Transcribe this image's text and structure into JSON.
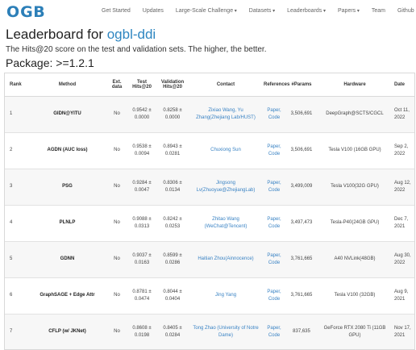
{
  "logo": {
    "text": "GB"
  },
  "nav": [
    {
      "label": "Get Started",
      "dropdown": false
    },
    {
      "label": "Updates",
      "dropdown": false
    },
    {
      "label": "Large-Scale Challenge",
      "dropdown": true
    },
    {
      "label": "Datasets",
      "dropdown": true
    },
    {
      "label": "Leaderboards",
      "dropdown": true
    },
    {
      "label": "Papers",
      "dropdown": true
    },
    {
      "label": "Team",
      "dropdown": false
    },
    {
      "label": "Github",
      "dropdown": false
    }
  ],
  "page": {
    "title_prefix": "Leaderboard for ",
    "title_dataset": "ogbl-ddi",
    "description": "The Hits@20 score on the test and validation sets. The higher, the better.",
    "package": "Package: >=1.2.1"
  },
  "table": {
    "headers": {
      "rank": "Rank",
      "method": "Method",
      "ext": "Ext. data",
      "test": "Test Hits@20",
      "val": "Validation Hits@20",
      "contact": "Contact",
      "refs": "References",
      "params": "#Params",
      "hardware": "Hardware",
      "date": "Date"
    },
    "rows": [
      {
        "rank": "1",
        "method": "GIDN@YITU",
        "ext": "No",
        "test": "0.9542 ± 0.0000",
        "val": "0.8258 ± 0.0000",
        "contact": "Zixiao Wang, Yu Zhang(Zhejiang Lab/HUST)",
        "refs": "Paper, Code",
        "params": "3,506,691",
        "hardware": "DeepGraph@SCTS/CGCL",
        "date": "Oct 11, 2022"
      },
      {
        "rank": "2",
        "method": "AGDN (AUC loss)",
        "ext": "No",
        "test": "0.9538 ± 0.0094",
        "val": "0.8943 ± 0.0281",
        "contact": "Chuxiong Sun",
        "refs": "Paper, Code",
        "params": "3,506,691",
        "hardware": "Tesla V100 (16GB GPU)",
        "date": "Sep 2, 2022"
      },
      {
        "rank": "3",
        "method": "PSG",
        "ext": "No",
        "test": "0.9284 ± 0.0047",
        "val": "0.8306 ± 0.0134",
        "contact": "Jingsong Lv(Zhuoyue@ZhejiangLab)",
        "refs": "Paper, Code",
        "params": "3,499,009",
        "hardware": "Tesla V100(32G GPU)",
        "date": "Aug 12, 2022"
      },
      {
        "rank": "4",
        "method": "PLNLP",
        "ext": "No",
        "test": "0.9088 ± 0.0313",
        "val": "0.8242 ± 0.0253",
        "contact": "Zhitao Wang (WeChat@Tencent)",
        "refs": "Paper, Code",
        "params": "3,497,473",
        "hardware": "Tesla-P40(24GB GPU)",
        "date": "Dec 7, 2021"
      },
      {
        "rank": "5",
        "method": "GDNN",
        "ext": "No",
        "test": "0.9037 ± 0.0163",
        "val": "0.8599 ± 0.0286",
        "contact": "Haitian Zhou(Ainnocence)",
        "refs": "Paper, Code",
        "params": "3,761,665",
        "hardware": "A40 NVLink(48GB)",
        "date": "Aug 30, 2022"
      },
      {
        "rank": "6",
        "method": "GraphSAGE + Edge Attr",
        "ext": "No",
        "test": "0.8781 ± 0.0474",
        "val": "0.8044 ± 0.0404",
        "contact": "Jing Yang",
        "refs": "Paper, Code",
        "params": "3,761,665",
        "hardware": "Tesla V100 (32GB)",
        "date": "Aug 9, 2021"
      },
      {
        "rank": "7",
        "method": "CFLP (w/ JKNet)",
        "ext": "No",
        "test": "0.8608 ± 0.0198",
        "val": "0.8405 ± 0.0284",
        "contact": "Tong Zhao (University of Notre Dame)",
        "refs": "Paper, Code",
        "params": "837,635",
        "hardware": "GeForce RTX 2080 Ti (11GB GPU)",
        "date": "Nov 17, 2021"
      }
    ]
  }
}
